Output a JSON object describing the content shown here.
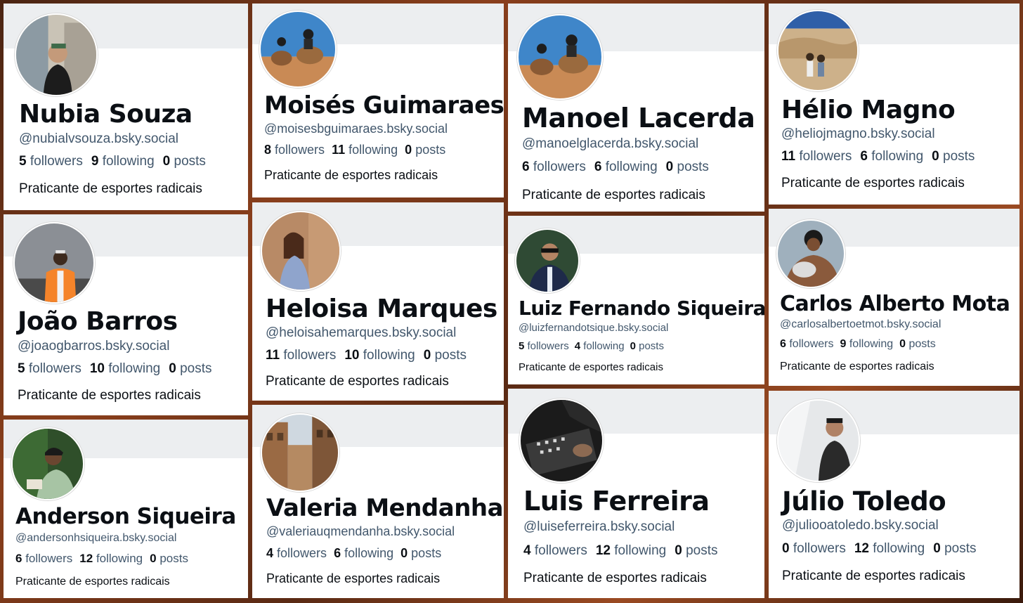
{
  "profiles": [
    {
      "name": "Nubia Souza",
      "handle": "@nubialvsouza.bsky.social",
      "followers": "5",
      "following": "9",
      "posts": "0",
      "bio": "Praticante de esportes radicais"
    },
    {
      "name": "Moisés Guimaraes",
      "handle": "@moisesbguimaraes.bsky.social",
      "followers": "8",
      "following": "11",
      "posts": "0",
      "bio": "Praticante de esportes radicais"
    },
    {
      "name": "Manoel Lacerda",
      "handle": "@manoelglacerda.bsky.social",
      "followers": "6",
      "following": "6",
      "posts": "0",
      "bio": "Praticante de esportes radicais"
    },
    {
      "name": "Hélio Magno",
      "handle": "@heliojmagno.bsky.social",
      "followers": "11",
      "following": "6",
      "posts": "0",
      "bio": "Praticante de esportes radicais"
    },
    {
      "name": "João Barros",
      "handle": "@joaogbarros.bsky.social",
      "followers": "5",
      "following": "10",
      "posts": "0",
      "bio": "Praticante de esportes radicais"
    },
    {
      "name": "Heloisa Marques",
      "handle": "@heloisahemarques.bsky.social",
      "followers": "11",
      "following": "10",
      "posts": "0",
      "bio": "Praticante de esportes radicais"
    },
    {
      "name": "Luiz Fernando Siqueira",
      "handle": "@luizfernandotsique.bsky.social",
      "followers": "5",
      "following": "4",
      "posts": "0",
      "bio": "Praticante de esportes radicais"
    },
    {
      "name": "Carlos Alberto Mota",
      "handle": "@carlosalbertoetmot.bsky.social",
      "followers": "6",
      "following": "9",
      "posts": "0",
      "bio": "Praticante de esportes radicais"
    },
    {
      "name": "Anderson Siqueira",
      "handle": "@andersonhsiqueira.bsky.social",
      "followers": "6",
      "following": "12",
      "posts": "0",
      "bio": "Praticante de esportes radicais"
    },
    {
      "name": "Valeria Mendanha",
      "handle": "@valeriauqmendanha.bsky.social",
      "followers": "4",
      "following": "6",
      "posts": "0",
      "bio": "Praticante de esportes radicais"
    },
    {
      "name": "Luis Ferreira",
      "handle": "@luiseferreira.bsky.social",
      "followers": "4",
      "following": "12",
      "posts": "0",
      "bio": "Praticante de esportes radicais"
    },
    {
      "name": "Júlio Toledo",
      "handle": "@juliooatoledo.bsky.social",
      "followers": "0",
      "following": "12",
      "posts": "0",
      "bio": "Praticante de esportes radicais"
    }
  ],
  "labels": {
    "followers": "followers",
    "following": "following",
    "posts": "posts"
  },
  "icons": {
    "avatar": "profile-photo"
  }
}
